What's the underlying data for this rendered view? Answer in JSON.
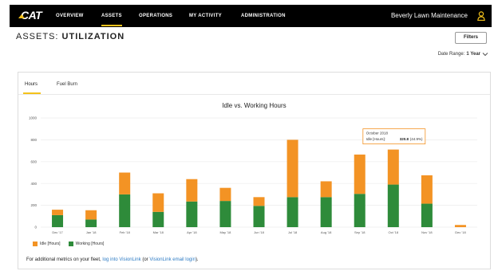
{
  "nav": {
    "logo": "CAT",
    "items": [
      {
        "label": "OVERVIEW",
        "active": false
      },
      {
        "label": "ASSETS",
        "active": true
      },
      {
        "label": "OPERATIONS",
        "active": false
      },
      {
        "label": "MY ACTIVITY",
        "active": false
      },
      {
        "label": "ADMINISTRATION",
        "active": false
      }
    ],
    "account_name": "Beverly Lawn Maintenance",
    "user_icon": "user-icon",
    "accent_color": "#f4c21b"
  },
  "header": {
    "title_prefix": "ASSETS:",
    "title_main": "UTILIZATION",
    "filters_label": "Filters",
    "date_range_label": "Date Range:",
    "date_range_value": "1 Year"
  },
  "tabs": [
    {
      "label": "Hours",
      "active": true
    },
    {
      "label": "Fuel Burn",
      "active": false
    }
  ],
  "chart_data": {
    "type": "bar",
    "stacked": true,
    "title": "Idle vs. Working Hours",
    "categories": [
      "Dec '17",
      "Jan '18",
      "Feb '18",
      "Mar '18",
      "Apr '18",
      "May '18",
      "Jun '18",
      "Jul '18",
      "Aug '18",
      "Sep '18",
      "Oct '18",
      "Nov '18",
      "Dec '18"
    ],
    "series": [
      {
        "name": "Working [Hours]",
        "color": "#2e8b3a",
        "values": [
          110,
          70,
          300,
          140,
          235,
          240,
          195,
          275,
          275,
          305,
          390,
          215,
          0
        ]
      },
      {
        "name": "Idle [Hours]",
        "color": "#f39324",
        "values": [
          50,
          85,
          200,
          170,
          205,
          120,
          80,
          525,
          145,
          360,
          320.8,
          260,
          20
        ]
      }
    ],
    "y_ticks": [
      0,
      200,
      400,
      600,
      800,
      1000
    ],
    "ylim": [
      0,
      1000
    ],
    "grid": true,
    "legend": "bottom-left",
    "tooltip": {
      "category_index": 10,
      "title": "October 2018",
      "label": "Idle [Hours]:",
      "value": "320.8",
      "percent": "(44.9%)"
    }
  },
  "footer": {
    "text": "For additional metrics on your fleet,",
    "link1": "log into VisionLink",
    "middle": "(or",
    "link2": "VisionLink email login",
    "end": ")."
  }
}
